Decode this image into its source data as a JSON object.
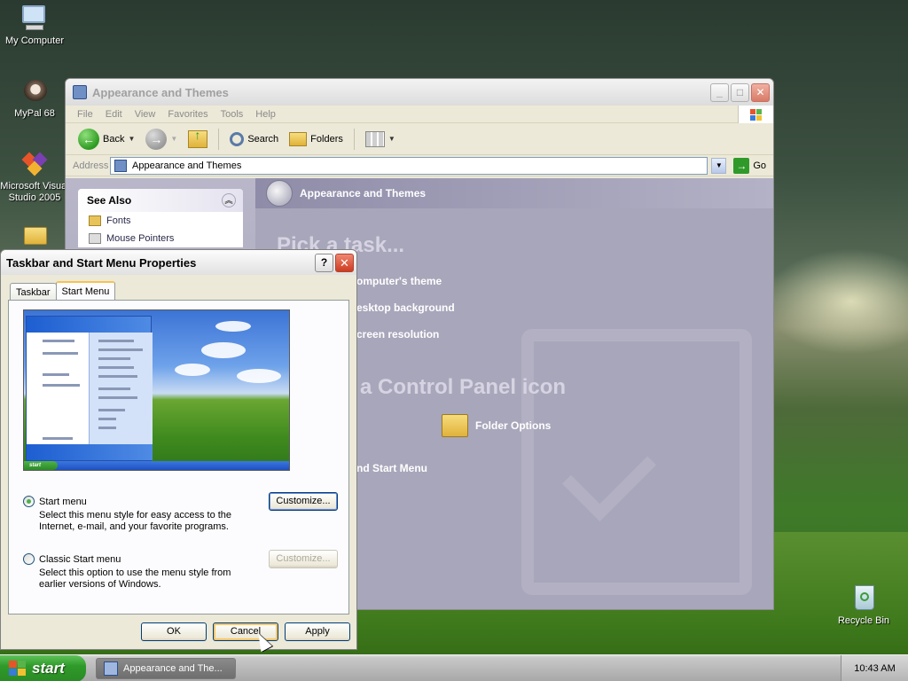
{
  "desktop": {
    "icons": [
      {
        "label": "My Computer",
        "icon": "my-computer-icon"
      },
      {
        "label": "MyPal 68",
        "icon": "mypal-icon"
      },
      {
        "label": "Microsoft Visual Studio 2005",
        "icon": "visual-studio-icon"
      },
      {
        "label": "",
        "icon": "folder-icon"
      },
      {
        "label": "Recycle Bin",
        "icon": "recycle-bin-icon"
      }
    ]
  },
  "explorer": {
    "title": "Appearance and Themes",
    "menu": [
      "File",
      "Edit",
      "View",
      "Favorites",
      "Tools",
      "Help"
    ],
    "toolbar": {
      "back": "Back",
      "search": "Search",
      "folders": "Folders"
    },
    "address": {
      "label": "Address",
      "value": "Appearance and Themes",
      "go": "Go"
    },
    "see_also": {
      "title": "See Also",
      "items": [
        "Fonts",
        "Mouse Pointers"
      ]
    },
    "content": {
      "header": "Appearance and Themes",
      "pick_task": "Pick a task...",
      "tasks": [
        "omputer's theme",
        "esktop background",
        "creen resolution"
      ],
      "pick_icon": "a Control Panel icon",
      "icons": [
        "Folder Options",
        "nd Start Menu"
      ]
    }
  },
  "dialog": {
    "title": "Taskbar and Start Menu Properties",
    "help": "?",
    "tabs": [
      "Taskbar",
      "Start Menu"
    ],
    "active_tab": "Start Menu",
    "options": [
      {
        "label": "Start menu",
        "selected": true,
        "description": "Select this menu style for easy access to the Internet, e-mail, and your favorite programs.",
        "button": "Customize...",
        "button_enabled": true
      },
      {
        "label": "Classic Start menu",
        "selected": false,
        "description": "Select this option to use the menu style from earlier versions of Windows.",
        "button": "Customize...",
        "button_enabled": false
      }
    ],
    "buttons": {
      "ok": "OK",
      "cancel": "Cancel",
      "apply": "Apply"
    }
  },
  "taskbar": {
    "start": "start",
    "task_item": "Appearance and The...",
    "clock": "10:43 AM"
  },
  "colors": {
    "xp_blue": "#1d5ed1",
    "start_green": "#2f9a2a",
    "focus_orange": "#f5c66b"
  }
}
